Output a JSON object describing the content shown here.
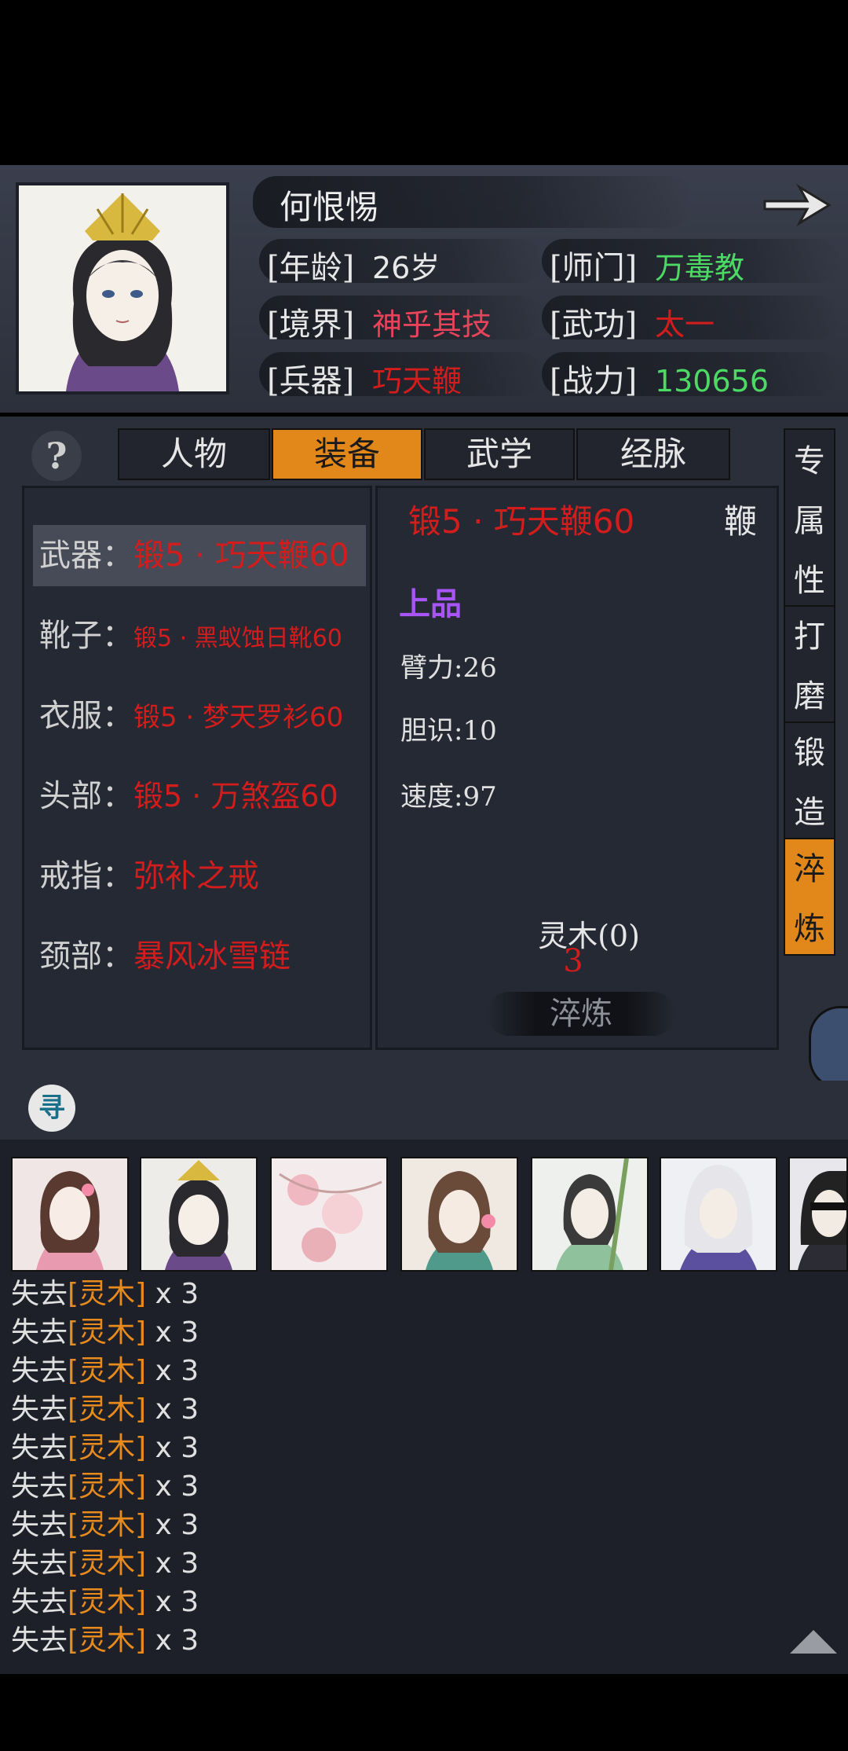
{
  "character": {
    "name": "何恨惕",
    "age_label": "[年龄]",
    "age": "26岁",
    "realm_label": "[境界]",
    "realm": "神乎其技",
    "weapon_label": "[兵器]",
    "weapon": "巧天鞭",
    "sect_label": "[师门]",
    "sect": "万毒教",
    "martial_label": "[武功]",
    "martial": "太一",
    "power_label": "[战力]",
    "power": "130656"
  },
  "help_icon": "?",
  "tabs": [
    {
      "label": "人物",
      "active": false
    },
    {
      "label": "装备",
      "active": true
    },
    {
      "label": "武学",
      "active": false
    },
    {
      "label": "经脉",
      "active": false
    }
  ],
  "equipment": [
    {
      "slot": "武器：",
      "item": "锻5 · 巧天鞭60",
      "selected": true
    },
    {
      "slot": "靴子：",
      "item": "锻5 · 黑蚁蚀日靴60"
    },
    {
      "slot": "衣服：",
      "item": "锻5 · 梦天罗衫60"
    },
    {
      "slot": "头部：",
      "item": "锻5 · 万煞盔60"
    },
    {
      "slot": "戒指：",
      "item": "弥补之戒"
    },
    {
      "slot": "颈部：",
      "item": "暴风冰雪链"
    }
  ],
  "detail": {
    "title": "锻5 · 巧天鞭60",
    "type": "鞭",
    "quality": "上品",
    "stats": [
      "臂力:26",
      "胆识:10",
      "速度:97"
    ],
    "material": "灵木(0)",
    "cost": "3",
    "action": "淬炼"
  },
  "side_buttons": [
    {
      "label": [
        "专",
        "属",
        "性"
      ],
      "active": false
    },
    {
      "label": [
        "打",
        "磨"
      ],
      "active": false
    },
    {
      "label": [
        "锻",
        "造"
      ],
      "active": false
    },
    {
      "label": [
        "淬",
        "炼"
      ],
      "active": true
    }
  ],
  "search_icon": "寻",
  "log": [
    {
      "prefix": "失去",
      "item": "[灵木]",
      "suffix": " x 3"
    },
    {
      "prefix": "失去",
      "item": "[灵木]",
      "suffix": " x 3"
    },
    {
      "prefix": "失去",
      "item": "[灵木]",
      "suffix": " x 3"
    },
    {
      "prefix": "失去",
      "item": "[灵木]",
      "suffix": " x 3"
    },
    {
      "prefix": "失去",
      "item": "[灵木]",
      "suffix": " x 3"
    },
    {
      "prefix": "失去",
      "item": "[灵木]",
      "suffix": " x 3"
    },
    {
      "prefix": "失去",
      "item": "[灵木]",
      "suffix": " x 3"
    },
    {
      "prefix": "失去",
      "item": "[灵木]",
      "suffix": " x 3"
    },
    {
      "prefix": "失去",
      "item": "[灵木]",
      "suffix": " x 3"
    },
    {
      "prefix": "失去",
      "item": "[灵木]",
      "suffix": " x 3"
    }
  ],
  "colors": {
    "accent_orange": "#e2871a",
    "red_text": "#d31c1c",
    "green_text": "#4cd964",
    "purple_quality": "#a855f7"
  }
}
